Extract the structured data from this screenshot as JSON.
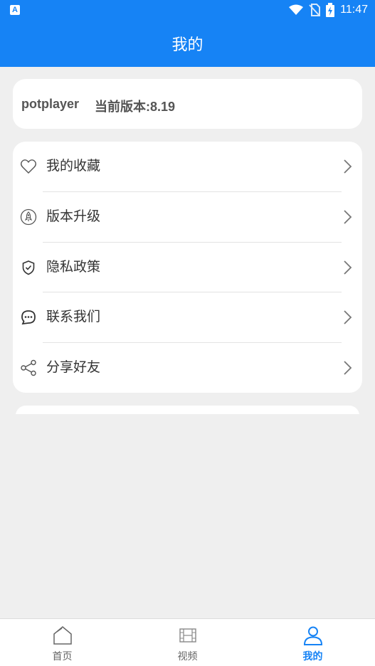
{
  "status_bar": {
    "time": "11:47",
    "icons": [
      "app-notification-icon",
      "wifi-icon",
      "no-sim-icon",
      "battery-charging-icon"
    ]
  },
  "header": {
    "title": "我的"
  },
  "app_info": {
    "name": "potplayer",
    "version": "当前版本:8.19"
  },
  "menu": [
    {
      "label": "我的收藏",
      "icon": "heart-icon"
    },
    {
      "label": "版本升级",
      "icon": "rocket-icon"
    },
    {
      "label": "隐私政策",
      "icon": "shield-check-icon"
    },
    {
      "label": "联系我们",
      "icon": "chat-bubble-icon"
    },
    {
      "label": "分享好友",
      "icon": "share-icon"
    }
  ],
  "tabs": [
    {
      "label": "首页",
      "icon": "home-icon",
      "active": false
    },
    {
      "label": "视频",
      "icon": "film-icon",
      "active": false
    },
    {
      "label": "我的",
      "icon": "user-icon",
      "active": true
    }
  ],
  "colors": {
    "primary": "#1683f5",
    "background": "#efefef",
    "card": "#ffffff",
    "text": "#333333",
    "inactive_tab": "#666666"
  }
}
